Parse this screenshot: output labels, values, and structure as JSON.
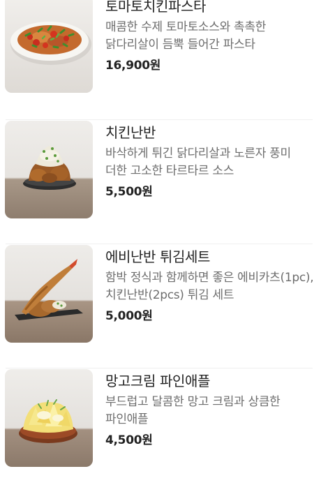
{
  "menu": {
    "items": [
      {
        "name": "토마토치킨파스타",
        "description": "매콤한 수제 토마토소스와 촉촉한 닭다리살이 듬뿍 들어간 파스타",
        "price": "16,900원",
        "image_icon": "tomato-chicken-pasta-photo"
      },
      {
        "name": "치킨난반",
        "description": "바삭하게 튀긴 닭다리살과 노른자 풍미 더한 고소한 타르타르 소스",
        "price": "5,500원",
        "image_icon": "chicken-nanban-photo"
      },
      {
        "name": "에비난반 튀김세트",
        "description": "함박 정식과 함께하면 좋은 에비카츠(1pc), 치킨난반(2pcs) 튀김 세트",
        "price": "5,000원",
        "image_icon": "ebi-nanban-fry-set-photo"
      },
      {
        "name": "망고크림 파인애플",
        "description": "부드럽고 달콤한 망고 크림과 상큼한 파인애플",
        "price": "4,500원",
        "image_icon": "mango-cream-pineapple-photo"
      }
    ]
  }
}
